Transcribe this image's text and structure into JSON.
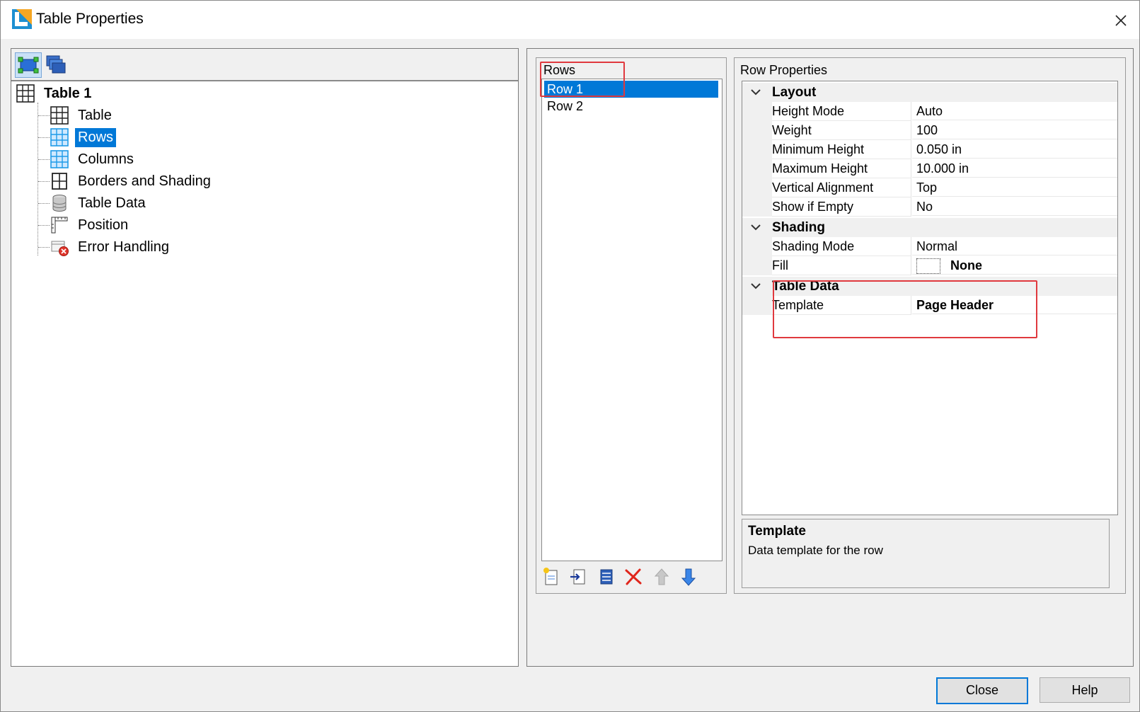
{
  "window": {
    "title": "Table Properties"
  },
  "tree": {
    "root": "Table 1",
    "items": [
      {
        "label": "Table",
        "icon": "table-grid-icon"
      },
      {
        "label": "Rows",
        "icon": "rows-grid-icon",
        "selected": true
      },
      {
        "label": "Columns",
        "icon": "columns-grid-icon"
      },
      {
        "label": "Borders and Shading",
        "icon": "borders-icon"
      },
      {
        "label": "Table Data",
        "icon": "database-icon"
      },
      {
        "label": "Position",
        "icon": "position-ruler-icon"
      },
      {
        "label": "Error Handling",
        "icon": "error-handling-icon"
      }
    ]
  },
  "rows_panel": {
    "caption": "Rows",
    "items": [
      "Row 1",
      "Row 2"
    ],
    "selected_index": 0
  },
  "props_panel": {
    "caption": "Row Properties",
    "categories": {
      "layout": {
        "label": "Layout",
        "props": [
          {
            "name": "Height Mode",
            "value": "Auto"
          },
          {
            "name": "Weight",
            "value": "100"
          },
          {
            "name": "Minimum Height",
            "value": "0.050 in"
          },
          {
            "name": "Maximum Height",
            "value": "10.000 in"
          },
          {
            "name": "Vertical Alignment",
            "value": "Top"
          },
          {
            "name": "Show if Empty",
            "value": "No"
          }
        ]
      },
      "shading": {
        "label": "Shading",
        "props": [
          {
            "name": "Shading Mode",
            "value": "Normal"
          },
          {
            "name": "Fill",
            "value": "None"
          }
        ]
      },
      "table_data": {
        "label": "Table Data",
        "props": [
          {
            "name": "Template",
            "value": "Page Header"
          }
        ]
      }
    },
    "description": {
      "title": "Template",
      "text": "Data template for the row"
    }
  },
  "buttons": {
    "close": "Close",
    "help": "Help"
  },
  "colors": {
    "selection": "#0078d7",
    "highlight": "#e0393e"
  }
}
